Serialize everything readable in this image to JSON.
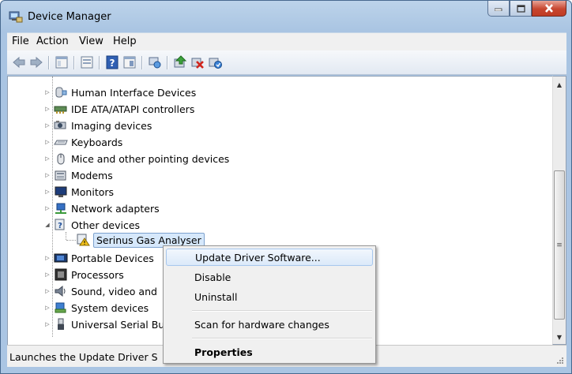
{
  "window": {
    "title": "Device Manager"
  },
  "menu": [
    {
      "label": "File"
    },
    {
      "label": "Action"
    },
    {
      "label": "View"
    },
    {
      "label": "Help"
    }
  ],
  "toolbar": {
    "buttons": [
      "back-arrow-icon",
      "forward-arrow-icon",
      "properties-icon",
      "show-hide-console-tree-icon",
      "help-icon",
      "view-icon",
      "scan-hardware-icon",
      "update-driver-icon",
      "uninstall-icon",
      "enable-device-icon"
    ]
  },
  "tree": {
    "items": [
      {
        "label": "Human Interface Devices",
        "icon": "hid-icon"
      },
      {
        "label": "IDE ATA/ATAPI controllers",
        "icon": "ide-controller-icon"
      },
      {
        "label": "Imaging devices",
        "icon": "camera-icon"
      },
      {
        "label": "Keyboards",
        "icon": "keyboard-icon"
      },
      {
        "label": "Mice and other pointing devices",
        "icon": "mouse-icon"
      },
      {
        "label": "Modems",
        "icon": "modem-icon"
      },
      {
        "label": "Monitors",
        "icon": "monitor-icon"
      },
      {
        "label": "Network adapters",
        "icon": "network-adapter-icon"
      },
      {
        "label": "Other devices",
        "icon": "unknown-device-icon",
        "expanded": true
      },
      {
        "label": "Serinus Gas Analyser",
        "icon": "warning-device-icon",
        "child": true,
        "selected": true
      },
      {
        "label": "Portable Devices",
        "icon": "portable-device-icon"
      },
      {
        "label": "Processors",
        "icon": "processor-icon"
      },
      {
        "label": "Sound, video and",
        "icon": "speaker-icon"
      },
      {
        "label": "System devices",
        "icon": "system-device-icon"
      },
      {
        "label": "Universal Serial Bu",
        "icon": "usb-icon"
      }
    ]
  },
  "context_menu": {
    "items": [
      {
        "label": "Update Driver Software...",
        "highlighted": true
      },
      {
        "label": "Disable"
      },
      {
        "label": "Uninstall"
      },
      {
        "label": "Scan for hardware changes"
      },
      {
        "label": "Properties",
        "bold": true
      }
    ]
  },
  "status": {
    "text": "Launches the Update Driver S"
  },
  "colors": {
    "selection": "#d6e8fb",
    "title_gradient": "#bcd3ea",
    "close_button": "#c7462f"
  }
}
